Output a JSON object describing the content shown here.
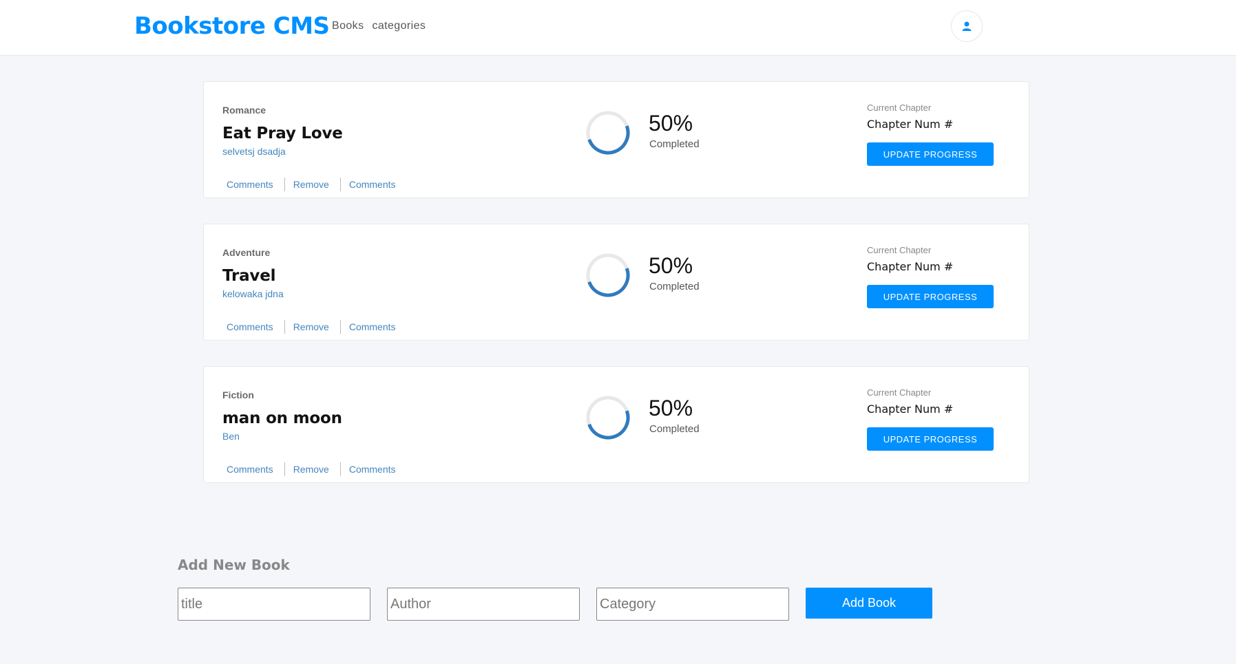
{
  "header": {
    "logo": "Bookstore CMS",
    "nav": [
      "Books",
      "categories"
    ],
    "user_icon": "user-icon"
  },
  "books": [
    {
      "category": "Romance",
      "title": "Eat Pray Love",
      "author": "selvetsj dsadja",
      "actions": [
        "Comments",
        "Remove",
        "Comments"
      ],
      "progress_value": 0.5,
      "percent_text": "50%",
      "completed_label": "Completed",
      "chapter_label": "Current Chapter",
      "chapter": "Chapter Num #",
      "update_label": "UPDATE PROGRESS"
    },
    {
      "category": "Adventure",
      "title": "Travel",
      "author": "kelowaka jdna",
      "actions": [
        "Comments",
        "Remove",
        "Comments"
      ],
      "progress_value": 0.5,
      "percent_text": "50%",
      "completed_label": "Completed",
      "chapter_label": "Current Chapter",
      "chapter": "Chapter Num #",
      "update_label": "UPDATE PROGRESS"
    },
    {
      "category": "Fiction",
      "title": "man on moon",
      "author": "Ben",
      "actions": [
        "Comments",
        "Remove",
        "Comments"
      ],
      "progress_value": 0.5,
      "percent_text": "50%",
      "completed_label": "Completed",
      "chapter_label": "Current Chapter",
      "chapter": "Chapter Num #",
      "update_label": "UPDATE PROGRESS"
    }
  ],
  "add_form": {
    "heading": "Add New Book",
    "title_placeholder": "title",
    "author_placeholder": "Author",
    "category_placeholder": "Category",
    "submit_label": "Add Book"
  },
  "colors": {
    "accent": "#0290ff",
    "link": "#4386bf",
    "background": "#f5f6fa",
    "progress_track": "#e8e8e8"
  }
}
